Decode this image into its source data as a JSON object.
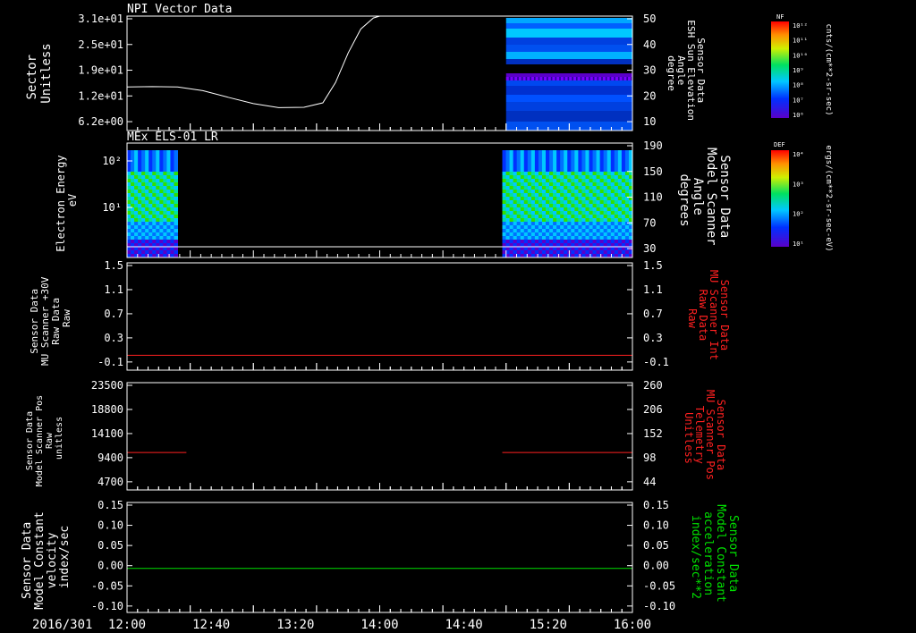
{
  "colors": {
    "background": "#000000",
    "axis": "#ffffff",
    "red": "#ff2020",
    "green": "#00e000"
  },
  "footer": {
    "date": "2016/301",
    "time_ticks": [
      "12:00",
      "12:40",
      "13:20",
      "14:00",
      "14:40",
      "15:20",
      "16:00"
    ]
  },
  "colorbars": [
    {
      "label": "NF",
      "unit": "cnts/(cm**2-sr-sec)",
      "ticks": [
        "10¹²",
        "10¹¹",
        "10¹⁰",
        "10⁹",
        "10⁸",
        "10⁷",
        "10⁶"
      ]
    },
    {
      "label": "DEF",
      "unit": "ergs/(cm**2-sr-sec-eV)",
      "ticks": [
        "10⁴",
        "10³",
        "10²",
        "10¹"
      ]
    }
  ],
  "chart_data": [
    {
      "type": "line",
      "title": "NPI Vector Data",
      "ylabel": [
        "Sector",
        "Unitless"
      ],
      "y_ticks": [
        "3.1e+01",
        "2.5e+01",
        "1.9e+01",
        "1.2e+01",
        "6.2e+00"
      ],
      "y_range": [
        0,
        31
      ],
      "x_range_hours": [
        12.0,
        16.0
      ],
      "series": [
        {
          "x": [
            12.0,
            12.2,
            12.4,
            12.6,
            12.8,
            13.0,
            13.2,
            13.4,
            13.55,
            13.65,
            13.75,
            13.85,
            13.95,
            14.0,
            14.05
          ],
          "y": [
            11.8,
            11.9,
            11.8,
            10.8,
            9.0,
            7.3,
            6.2,
            6.3,
            7.5,
            13.0,
            21.0,
            27.5,
            30.5,
            31.0,
            31.0
          ]
        }
      ],
      "right_axis": {
        "ticks": [
          "50",
          "40",
          "30",
          "20",
          "10"
        ],
        "range": [
          0,
          50
        ],
        "label": [
          "Sensor Data",
          "ESH Sun Elevation",
          "Angle",
          "degree"
        ]
      },
      "spectrogram": {
        "x_range_hours": [
          15.0,
          16.0
        ],
        "colormap": "NF"
      }
    },
    {
      "type": "heatmap",
      "title": "MEx ELS-01 LR",
      "ylabel": [
        "Electron Energy",
        "eV"
      ],
      "y_ticks": [
        "10²",
        "10¹"
      ],
      "y_scale": "log",
      "right_axis": {
        "ticks": [
          "190",
          "150",
          "110",
          "70",
          "30"
        ],
        "range": [
          10,
          190
        ],
        "label": [
          "Sensor Data",
          "Model Scanner",
          "Angle",
          "degrees"
        ]
      },
      "blocks": [
        {
          "x_range_hours": [
            12.0,
            12.4
          ]
        },
        {
          "x_range_hours": [
            14.97,
            16.0
          ]
        }
      ],
      "colormap": "DEF"
    },
    {
      "type": "line",
      "ylabel": [
        "Sensor Data",
        "MU Scanner +30V",
        "Raw Data",
        "Raw"
      ],
      "y_ticks": [
        "1.5",
        "1.1",
        "0.7",
        "0.3",
        "-0.1"
      ],
      "y_range": [
        -0.3,
        1.5
      ],
      "right_axis": {
        "ticks": [
          "1.5",
          "1.1",
          "0.7",
          "0.3",
          "-0.1"
        ],
        "label": [
          "Sensor Data",
          "MU Scanner Int",
          "Raw Data",
          "Raw"
        ],
        "color": "red"
      },
      "series": [
        {
          "color": "red",
          "x": [
            12.0,
            16.0
          ],
          "y": [
            -0.05,
            -0.05
          ]
        }
      ]
    },
    {
      "type": "line",
      "ylabel": [
        "Sensor Data",
        "Model Scanner Pos",
        "Raw",
        "unitless"
      ],
      "y_ticks": [
        "23500",
        "18800",
        "14100",
        "9400",
        "4700"
      ],
      "y_range": [
        0,
        23500
      ],
      "right_axis": {
        "ticks": [
          "260",
          "206",
          "152",
          "98",
          "44"
        ],
        "label": [
          "Sensor Data",
          "MU Scanner Pos",
          "Telemetry",
          "Unitless"
        ],
        "color": "red"
      },
      "series": [
        {
          "color": "red",
          "segments": [
            {
              "x": [
                12.0,
                12.47
              ],
              "y": [
                8200,
                8200
              ]
            },
            {
              "x": [
                14.97,
                16.0
              ],
              "y": [
                8200,
                8200
              ]
            }
          ]
        }
      ]
    },
    {
      "type": "line",
      "ylabel": [
        "Sensor Data",
        "Model Constant",
        "velocity",
        "index/sec"
      ],
      "y_ticks": [
        "0.15",
        "0.10",
        "0.05",
        "0.00",
        "-0.05",
        "-0.10"
      ],
      "y_range": [
        -0.1,
        0.15
      ],
      "right_axis": {
        "ticks": [
          "0.15",
          "0.10",
          "0.05",
          "0.00",
          "-0.05",
          "-0.10"
        ],
        "label": [
          "Sensor Data",
          "Model Constant",
          "acceleration",
          "index/sec**2"
        ],
        "color": "green"
      },
      "series": [
        {
          "color": "green",
          "x": [
            12.0,
            16.0
          ],
          "y": [
            0.0,
            0.0
          ]
        }
      ]
    }
  ]
}
